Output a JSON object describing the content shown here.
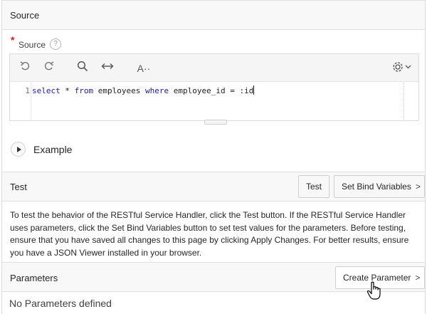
{
  "source_section": {
    "title": "Source",
    "field_label": "Source",
    "required_mark": "*",
    "help_icon": "?"
  },
  "editor": {
    "toolbar": {
      "undo_icon": "undo-icon",
      "redo_icon": "redo-icon",
      "search_icon": "search-icon",
      "expand_icon": "horizontal-arrows-icon",
      "autocomplete_icon": "A··",
      "settings_icon": "gear-icon"
    },
    "line_number": "1",
    "code_parts": {
      "select": "select",
      "star": " * ",
      "from": "from",
      "table": " employees ",
      "where": "where",
      "condition": " employee_id = :id"
    }
  },
  "example": {
    "label": "Example"
  },
  "test_section": {
    "title": "Test",
    "test_button": "Test",
    "bind_button": "Set Bind Variables",
    "description": "To test the behavior of the RESTful Service Handler, click the Test button. If the RESTful Service Handler uses parameters, click the Set Bind Variables button to set test values for the parameters. Before testing, ensure that you have saved all changes to this page by clicking Apply Changes. For better results, ensure you have a JSON Viewer installed in your browser."
  },
  "parameters_section": {
    "title": "Parameters",
    "create_button": "Create Parameter",
    "empty_message": "No Parameters defined"
  },
  "colors": {
    "required": "#e5141b",
    "keyword": "#1a1aa6",
    "header_bg": "#f8f8f8"
  }
}
